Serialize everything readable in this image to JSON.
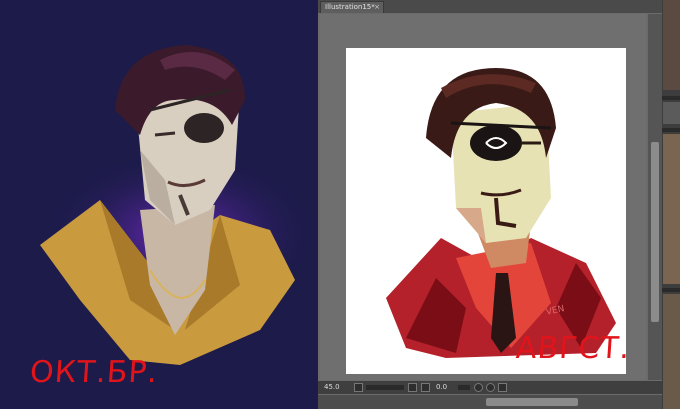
{
  "document_tab": {
    "label": "Illustration15*",
    "close_glyph": "×"
  },
  "status_bar": {
    "zoom": "45.0",
    "angle": "0.0"
  },
  "left_caption": "ОКТ.БР.",
  "right_caption": "АВГСТ.",
  "signature": "VEN",
  "icons": {
    "status_buttons": [
      "zoom-out-icon",
      "zoom-in-icon",
      "fit-icon",
      "rotate-left-icon",
      "rotate-right-icon",
      "flip-icon"
    ]
  },
  "colors": {
    "left_background": "#1c1b4a",
    "caption_red": "#e1141b",
    "app_gray": "#6b6b6b"
  }
}
